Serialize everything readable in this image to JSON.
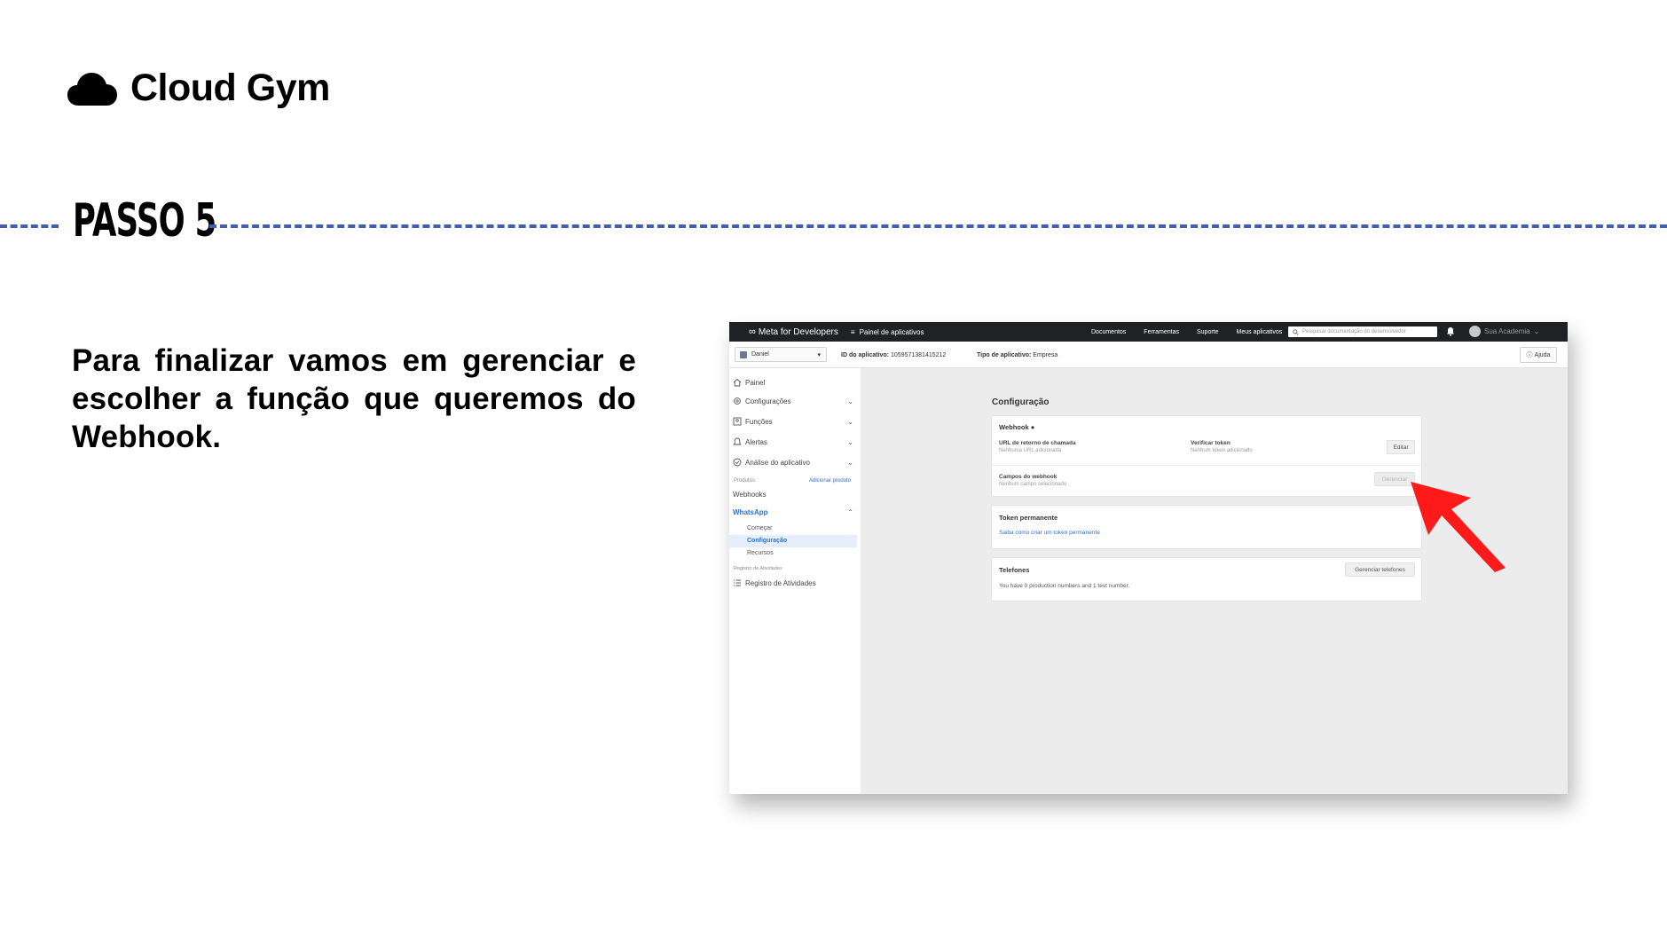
{
  "brand": {
    "name": "Cloud Gym",
    "icon": "cloud-icon"
  },
  "step": {
    "title": "PASSO 5"
  },
  "instructions": {
    "text": "Para finalizar vamos em gerenciar e escolher a função que queremos do Webhook."
  },
  "accent_color": "#3f5fb4",
  "pointer_color": "#ff1a1a",
  "screenshot": {
    "topbar": {
      "logo": "Meta for Developers",
      "panel_link": "Painel de aplicativos",
      "links": [
        "Documentos",
        "Ferramentas",
        "Suporte",
        "Meus aplicativos"
      ],
      "search_placeholder": "Pesquisar documentação do desenvolvedor",
      "user_name": "Sua Academia"
    },
    "subbar": {
      "app_name": "Daniel",
      "app_id_label": "ID do aplicativo:",
      "app_id": "1059571381415212",
      "app_type_label": "Tipo de aplicativo:",
      "app_type": "Empresa",
      "help": "Ajuda"
    },
    "sidebar": {
      "items": [
        "Painel",
        "Configurações",
        "Funções",
        "Alertas",
        "Análise do aplicativo"
      ],
      "products_caption": "Produtos",
      "add_product": "Adicionar produto",
      "webhooks": "Webhooks",
      "whatsapp": "WhatsApp",
      "whatsapp_items": [
        "Começar",
        "Configuração",
        "Recursos"
      ],
      "activity_caption": "Registro de Atividades",
      "activity_item": "Registro de Atividades"
    },
    "main": {
      "title": "Configuração",
      "webhook": {
        "title": "Webhook",
        "callback_label": "URL de retorno de chamada",
        "callback_value": "Nenhuma URL adicionada",
        "verify_label": "Verificar token",
        "verify_value": "Nenhum token adicionado",
        "edit_button": "Editar",
        "fields_label": "Campos do webhook",
        "fields_value": "Nenhum campo selecionado",
        "manage_button": "Gerenciar"
      },
      "token": {
        "title": "Token permanente",
        "link": "Saiba como criar um token permanente"
      },
      "phones": {
        "title": "Telefones",
        "manage_button": "Gerenciar telefones",
        "summary": "You have 0 production numbers and 1 test number."
      }
    }
  }
}
